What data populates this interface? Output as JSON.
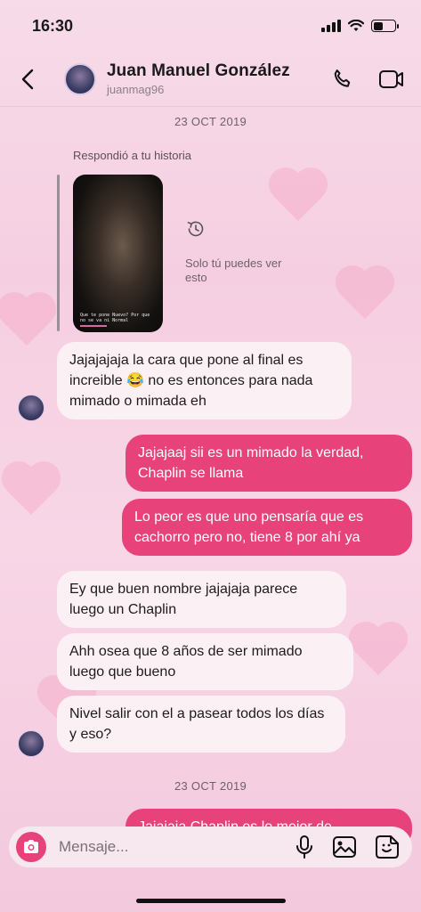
{
  "status_bar": {
    "time": "16:30"
  },
  "header": {
    "name": "Juan Manuel González",
    "username": "juanmag96"
  },
  "dates": [
    "23 OCT 2019",
    "23 OCT 2019"
  ],
  "story_reply": {
    "label": "Respondió a tu historia",
    "caption": "Que te pone Nuevo? Por que no se va ni Normal",
    "private_note": "Solo tú puedes ver esto"
  },
  "messages": [
    {
      "from": "them",
      "text": "Jajajajaja la cara que pone al final es increible 😂 no es entonces para nada mimado o mimada eh"
    },
    {
      "from": "me",
      "text": "Jajajaaj sii es un mimado la verdad, Chaplin se llama"
    },
    {
      "from": "me",
      "text": "Lo peor es que uno pensaría que es cachorro pero no, tiene 8 por ahí ya"
    },
    {
      "from": "them",
      "text": "Ey que buen nombre jajajaja parece luego un Chaplin"
    },
    {
      "from": "them",
      "text": "Ahh osea que 8 años de ser mimado luego que bueno"
    },
    {
      "from": "them",
      "text": "Nivel salir con el a pasear todos los días y eso?"
    },
    {
      "from": "me",
      "text": "Jajajaja Chaplin es lo mejor de"
    }
  ],
  "composer": {
    "placeholder": "Mensaje..."
  },
  "colors": {
    "accent": "#e8427a",
    "incoming_bubble": "#fbf1f5"
  }
}
